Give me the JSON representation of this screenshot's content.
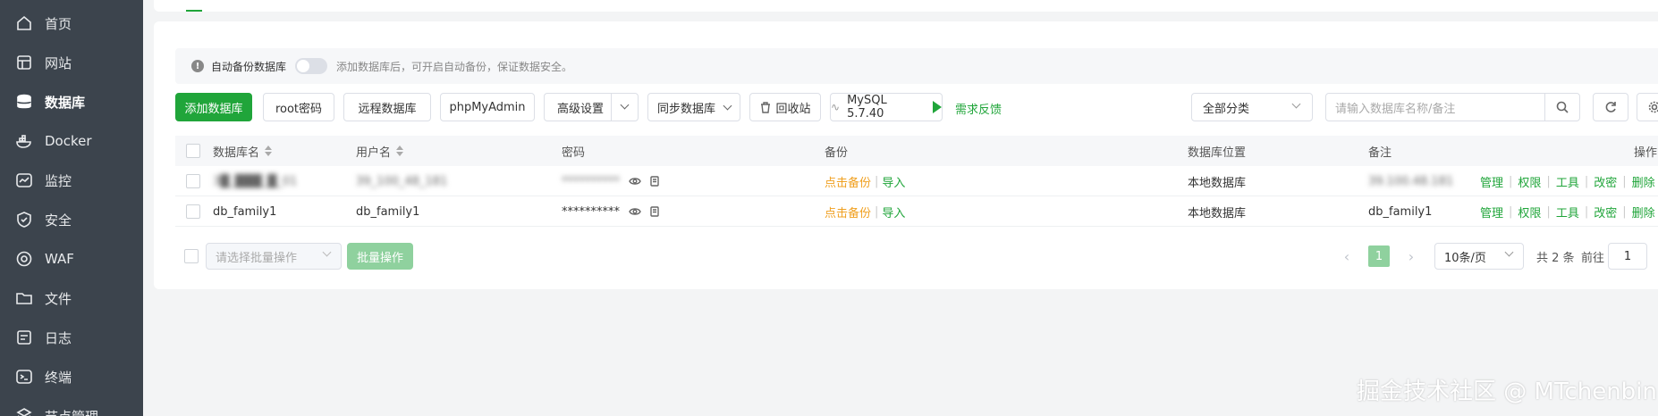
{
  "sidebar": {
    "items": [
      {
        "label": "首页",
        "icon": "home-icon"
      },
      {
        "label": "网站",
        "icon": "website-icon"
      },
      {
        "label": "数据库",
        "icon": "database-icon",
        "active": true
      },
      {
        "label": "Docker",
        "icon": "docker-icon"
      },
      {
        "label": "监控",
        "icon": "monitor-icon"
      },
      {
        "label": "安全",
        "icon": "shield-icon"
      },
      {
        "label": "WAF",
        "icon": "waf-icon"
      },
      {
        "label": "文件",
        "icon": "folder-icon"
      },
      {
        "label": "日志",
        "icon": "log-icon"
      },
      {
        "label": "终端",
        "icon": "terminal-icon"
      },
      {
        "label": "节点管理",
        "icon": "node-icon"
      }
    ]
  },
  "notice": {
    "label": "自动备份数据库",
    "hint": "添加数据库后，可开启自动备份，保证数据安全。"
  },
  "toolbar": {
    "add_db": "添加数据库",
    "root_pwd": "root密码",
    "remote_db": "远程数据库",
    "phpmyadmin": "phpMyAdmin",
    "advanced": "高级设置",
    "sync_db": "同步数据库",
    "recycle": "回收站",
    "mysql_version": "MySQL 5.7.40",
    "feedback": "需求反馈",
    "category": "全部分类",
    "search_placeholder": "请输入数据库名称/备注"
  },
  "table": {
    "headers": {
      "name": "数据库名",
      "user": "用户名",
      "password": "密码",
      "backup": "备份",
      "location": "数据库位置",
      "remark": "备注",
      "actions": "操作"
    },
    "rows": [
      {
        "name": "3█_███_█_01",
        "user": "39_100_48_181",
        "password": "**********",
        "backup": "点击备份",
        "import": "导入",
        "location": "本地数据库",
        "remark": "39.100.48.181",
        "actions": [
          "管理",
          "权限",
          "工具",
          "改密",
          "删除"
        ]
      },
      {
        "name": "db_family1",
        "user": "db_family1",
        "password": "**********",
        "backup": "点击备份",
        "import": "导入",
        "location": "本地数据库",
        "remark": "db_family1",
        "actions": [
          "管理",
          "权限",
          "工具",
          "改密",
          "删除"
        ]
      }
    ]
  },
  "footer": {
    "batch_placeholder": "请选择批量操作",
    "batch_button": "批量操作",
    "current_page": "1",
    "page_size": "10条/页",
    "total": "共 2 条",
    "goto_label": "前往",
    "goto_value": "1"
  },
  "watermark": "掘金技术社区 @ MTchenbin",
  "colors": {
    "sidebar_bg": "#3c444d",
    "accent": "#20a53a",
    "backup_link": "#f0a020"
  }
}
